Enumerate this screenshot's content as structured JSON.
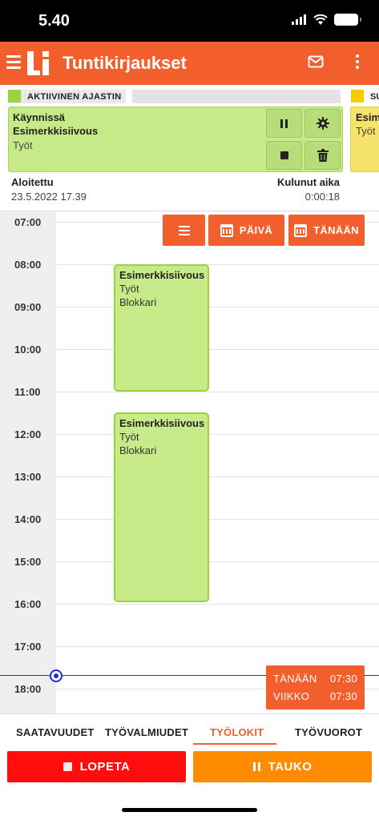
{
  "status_bar": {
    "time": "5.40"
  },
  "app_bar": {
    "title": "Tuntikirjaukset",
    "logo_text": "Li"
  },
  "active_timer": {
    "label": "AKTIIVINEN AJASTIN",
    "status": "Käynnissä",
    "name": "Esimerkkisiivous",
    "category": "Työt",
    "started_label": "Aloitettu",
    "started_value": "23.5.2022 17.39",
    "elapsed_label": "Kulunut aika",
    "elapsed_value": "0:00:18"
  },
  "second_timer": {
    "label": "SU",
    "name": "Esimerkkisiivous",
    "category": "Työt"
  },
  "calendar": {
    "hours": [
      "07:00",
      "08:00",
      "09:00",
      "10:00",
      "11:00",
      "12:00",
      "13:00",
      "14:00",
      "15:00",
      "16:00",
      "17:00",
      "18:00"
    ],
    "buttons": {
      "day": "PÄIVÄ",
      "today": "TÄNÄÄN"
    },
    "events": [
      {
        "title": "Esimerkkisiivous",
        "category": "Työt",
        "person": "Blokkari"
      },
      {
        "title": "Esimerkkisiivous",
        "category": "Työt",
        "person": "Blokkari"
      }
    ],
    "summary": {
      "today_label": "TÄNÄÄN",
      "today_value": "07:30",
      "week_label": "VIIKKO",
      "week_value": "07:30"
    }
  },
  "tabs": [
    "SAATAVUUDET",
    "TYÖVALMIUDET",
    "TYÖLOKIT",
    "TYÖVUOROT"
  ],
  "active_tab": "TYÖLOKIT",
  "actions": {
    "stop": "LOPETA",
    "pause": "TAUKO"
  },
  "colors": {
    "brand": "#f25f2c",
    "event": "#c8eb8a",
    "stop": "#ff0d0d",
    "pause": "#ff8c00",
    "now_line": "#1f2dd6"
  }
}
